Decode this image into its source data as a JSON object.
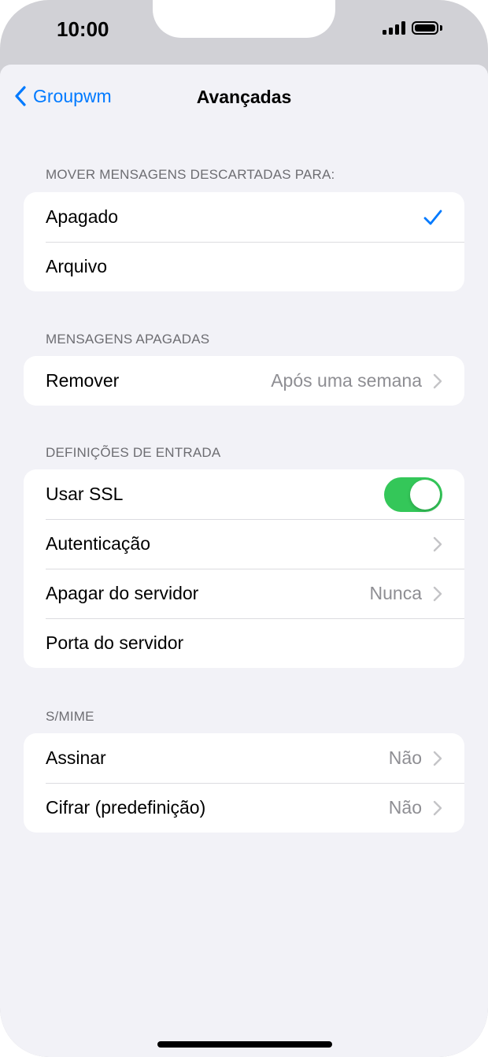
{
  "status_bar": {
    "time": "10:00"
  },
  "nav": {
    "back_label": "Groupwm",
    "title": "Avançadas"
  },
  "sections": {
    "discarded": {
      "header": "MOVER MENSAGENS DESCARTADAS PARA:",
      "options": [
        "Apagado",
        "Arquivo"
      ],
      "selected": "Apagado"
    },
    "deleted": {
      "header": "MENSAGENS APAGADAS",
      "remove_label": "Remover",
      "remove_value": "Após uma semana"
    },
    "incoming": {
      "header": "DEFINIÇÕES DE ENTRADA",
      "ssl_label": "Usar SSL",
      "ssl_on": true,
      "auth_label": "Autenticação",
      "delete_label": "Apagar do servidor",
      "delete_value": "Nunca",
      "port_label": "Porta do servidor"
    },
    "smime": {
      "header": "S/MIME",
      "sign_label": "Assinar",
      "sign_value": "Não",
      "encrypt_label": "Cifrar (predefinição)",
      "encrypt_value": "Não"
    }
  },
  "colors": {
    "accent": "#007aff",
    "toggle_on": "#34c759",
    "background": "#f2f2f7"
  }
}
